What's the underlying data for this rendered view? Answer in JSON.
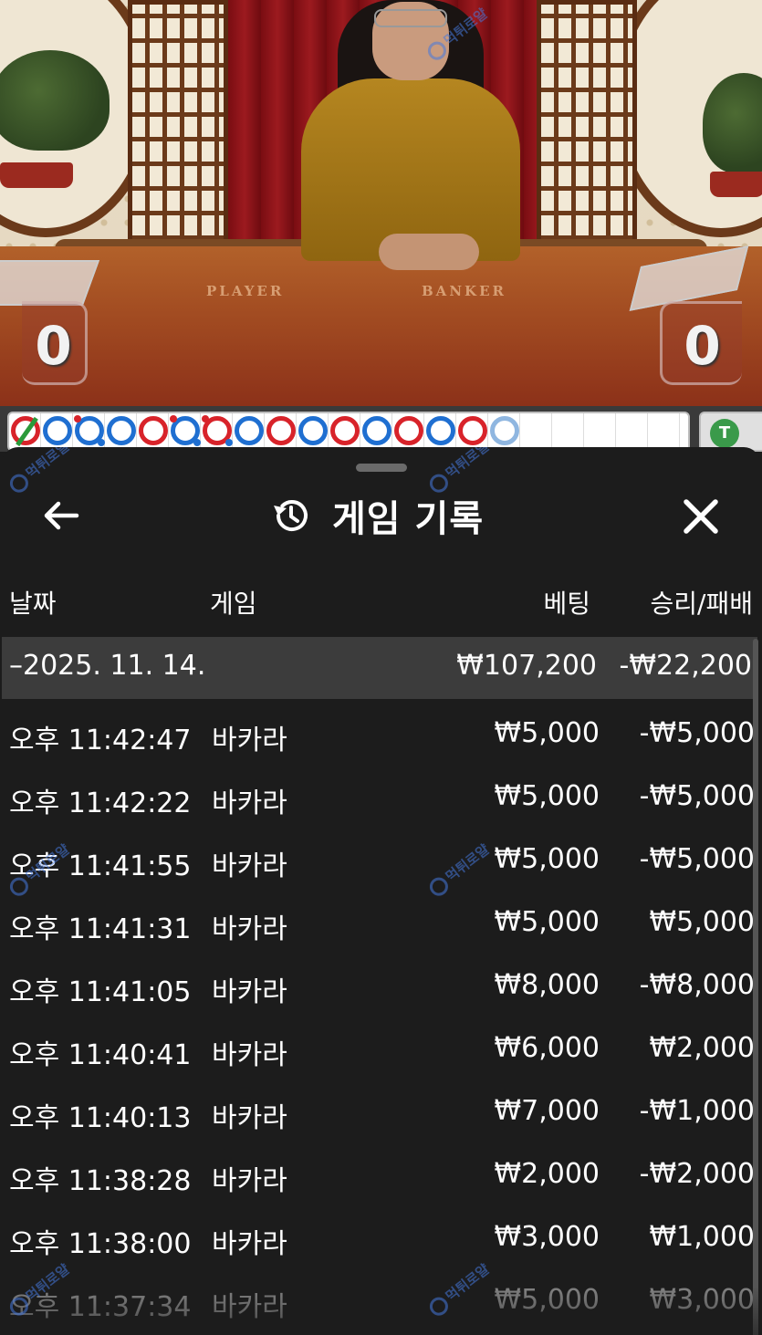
{
  "video": {
    "player_label": "PLAYER",
    "banker_label": "BANKER",
    "player_score": "0",
    "banker_score": "0"
  },
  "roadmap": {
    "beads": [
      "green-slash",
      "blue",
      "blue-dots",
      "blue",
      "red",
      "blue-dots",
      "red-dots",
      "blue",
      "red",
      "blue",
      "red",
      "blue",
      "red",
      "blue",
      "red",
      "light"
    ],
    "tie_label": "T",
    "colors": {
      "player": "#1f6fd1",
      "banker": "#d8232a",
      "tie": "#2a9a3a"
    }
  },
  "watermark": "먹튀로얄",
  "sheet": {
    "title": "게임 기록",
    "history_icon": "history-icon",
    "back_icon": "arrow-left-icon",
    "close_icon": "close-icon",
    "columns": {
      "date": "날짜",
      "game": "게임",
      "bet": "베팅",
      "win_loss": "승리/패배"
    },
    "day": {
      "date": "–2025. 11. 14.",
      "bet": "₩107,200",
      "win_loss": "-₩22,200"
    },
    "rows": [
      {
        "time": "오후 11:42:47",
        "game": "바카라",
        "bet": "₩5,000",
        "win_loss": "-₩5,000"
      },
      {
        "time": "오후 11:42:22",
        "game": "바카라",
        "bet": "₩5,000",
        "win_loss": "-₩5,000"
      },
      {
        "time": "오후 11:41:55",
        "game": "바카라",
        "bet": "₩5,000",
        "win_loss": "-₩5,000"
      },
      {
        "time": "오후 11:41:31",
        "game": "바카라",
        "bet": "₩5,000",
        "win_loss": "₩5,000"
      },
      {
        "time": "오후 11:41:05",
        "game": "바카라",
        "bet": "₩8,000",
        "win_loss": "-₩8,000"
      },
      {
        "time": "오후 11:40:41",
        "game": "바카라",
        "bet": "₩6,000",
        "win_loss": "₩2,000"
      },
      {
        "time": "오후 11:40:13",
        "game": "바카라",
        "bet": "₩7,000",
        "win_loss": "-₩1,000"
      },
      {
        "time": "오후 11:38:28",
        "game": "바카라",
        "bet": "₩2,000",
        "win_loss": "-₩2,000"
      },
      {
        "time": "오후 11:38:00",
        "game": "바카라",
        "bet": "₩3,000",
        "win_loss": "₩1,000"
      },
      {
        "time": "오후 11:37:34",
        "game": "바카라",
        "bet": "₩5,000",
        "win_loss": "₩3,000"
      }
    ]
  }
}
